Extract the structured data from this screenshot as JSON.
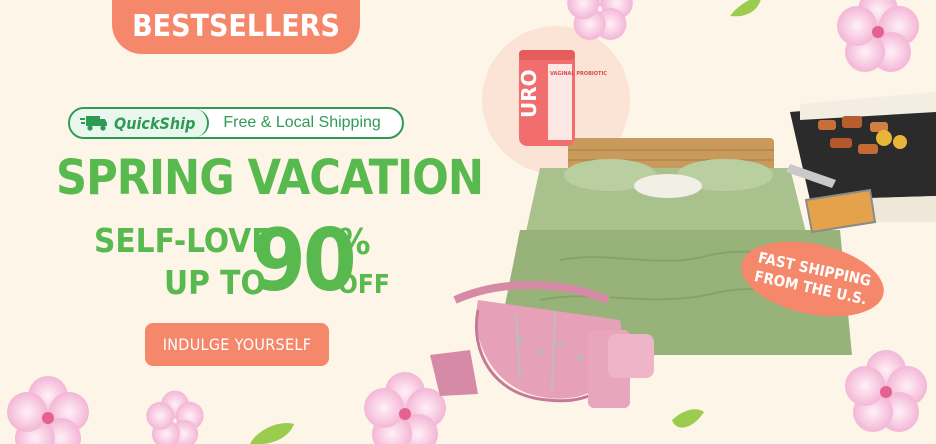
{
  "banner": {
    "top_label": "BESTSELLERS",
    "quickship": {
      "brand": "QuickShip",
      "text": "Free & Local Shipping"
    },
    "headline": "SPRING VACATION",
    "subline_1": "SELF-LOVE",
    "subline_2": "UP TO",
    "discount_number": "90",
    "discount_symbol": "%",
    "discount_suffix": "OFF",
    "cta_label": "INDULGE YOURSELF",
    "badge_line_1": "FAST SHIPPING",
    "badge_line_2": "FROM THE U.S.",
    "product_jar_brand": "URO",
    "product_jar_label": "VAGINAL PROBIOTIC"
  },
  "colors": {
    "background": "#fdf5e8",
    "accent_coral": "#f5876a",
    "headline_green": "#58b94e",
    "quickship_green": "#2f9a55"
  }
}
